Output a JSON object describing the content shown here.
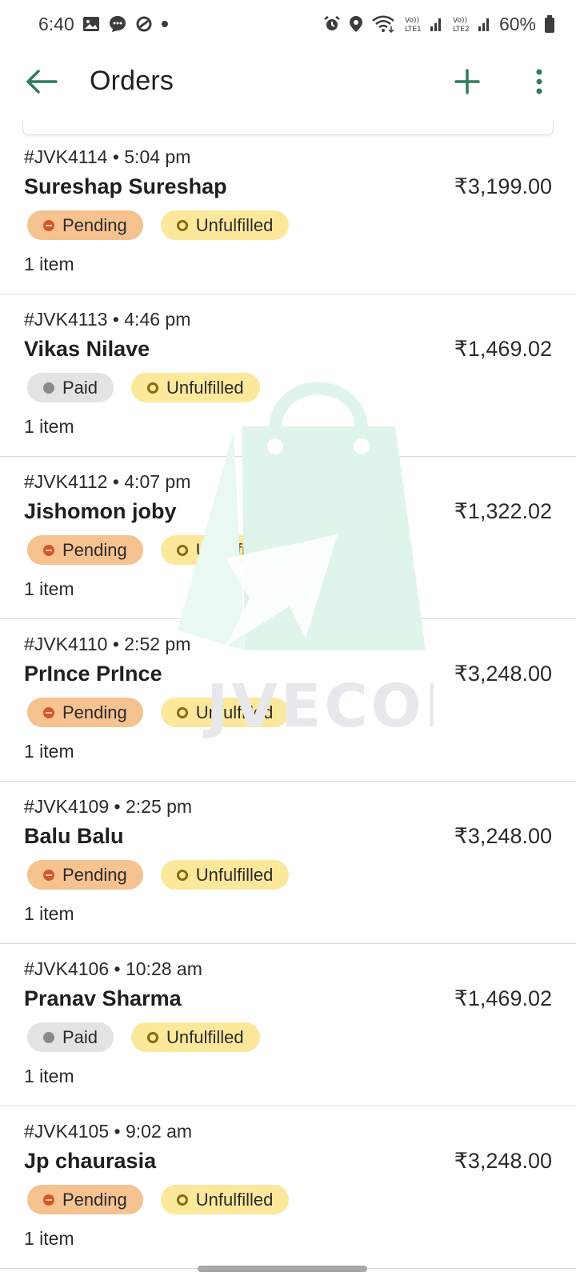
{
  "status_bar": {
    "time": "6:40",
    "battery": "60%",
    "left_icons": [
      "gallery-icon",
      "messages-icon",
      "sync-icon",
      "dot-icon"
    ],
    "right_icons": [
      "alarm-icon",
      "location-icon",
      "wifi-icon",
      "volte-lte1-icon",
      "volte-lte2-icon",
      "battery-icon"
    ],
    "sim1": "Vo) LTE1",
    "sim2": "Vo) LTE2"
  },
  "app_bar": {
    "title": "Orders",
    "back_icon": "arrow-left-icon",
    "add_icon": "plus-icon",
    "more_icon": "more-vertical-icon"
  },
  "watermark": {
    "text": "JVECOM",
    "icon": "shopping-bag-icon"
  },
  "colors": {
    "accent": "#2e7d5b",
    "pending_bg": "#f5c290",
    "paid_bg": "#e3e3e3",
    "unfulfilled_bg": "#fbe89b",
    "watermark_green": "#dff5ea"
  },
  "orders": [
    {
      "id_time": "#JVK4114 • 5:04 pm",
      "customer": "Sureshap Sureshap",
      "total": "₹3,199.00",
      "payment": "Pending",
      "payment_status": "pending",
      "fulfillment": "Unfulfilled",
      "items": "1 item"
    },
    {
      "id_time": "#JVK4113 • 4:46 pm",
      "customer": "Vikas Nilave",
      "total": "₹1,469.02",
      "payment": "Paid",
      "payment_status": "paid",
      "fulfillment": "Unfulfilled",
      "items": "1 item"
    },
    {
      "id_time": "#JVK4112 • 4:07 pm",
      "customer": "Jishomon joby",
      "total": "₹1,322.02",
      "payment": "Pending",
      "payment_status": "pending",
      "fulfillment": "Unfulfilled",
      "items": "1 item"
    },
    {
      "id_time": "#JVK4110 • 2:52 pm",
      "customer": "PrInce PrInce",
      "total": "₹3,248.00",
      "payment": "Pending",
      "payment_status": "pending",
      "fulfillment": "Unfulfilled",
      "items": "1 item"
    },
    {
      "id_time": "#JVK4109 • 2:25 pm",
      "customer": "Balu Balu",
      "total": "₹3,248.00",
      "payment": "Pending",
      "payment_status": "pending",
      "fulfillment": "Unfulfilled",
      "items": "1 item"
    },
    {
      "id_time": "#JVK4106 • 10:28 am",
      "customer": "Pranav Sharma",
      "total": "₹1,469.02",
      "payment": "Paid",
      "payment_status": "paid",
      "fulfillment": "Unfulfilled",
      "items": "1 item"
    },
    {
      "id_time": "#JVK4105 • 9:02 am",
      "customer": "Jp chaurasia",
      "total": "₹3,248.00",
      "payment": "Pending",
      "payment_status": "pending",
      "fulfillment": "Unfulfilled",
      "items": "1 item"
    }
  ]
}
